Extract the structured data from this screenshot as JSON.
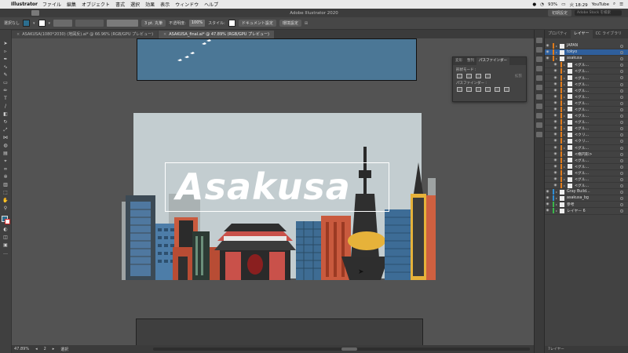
{
  "menubar": {
    "app": "Illustrator",
    "menus": [
      "ファイル",
      "編集",
      "オブジェクト",
      "書式",
      "選択",
      "効果",
      "表示",
      "ウィンドウ",
      "ヘルプ"
    ],
    "battery": "93%",
    "clock": "火 18:29",
    "user": "YouTube"
  },
  "titlebar": {
    "title": "Adobe Illustrator 2020",
    "workspace_btn": "初期設定",
    "search_placeholder": "Adobe Stock を検索"
  },
  "controlbar": {
    "selection": "選択なし",
    "stroke_width": "3 pt. 丸筆",
    "opacity_label": "不透明度:",
    "opacity": "100%",
    "style_label": "スタイル:",
    "doc_settings": "ドキュメント設定",
    "prefs": "環境設定",
    "fill_color": "#2c6e8f"
  },
  "tabs": [
    {
      "label": "ASAKUSA(1080*2030) (地図反).ai* @ 66.96% (RGB/GPU プレビュー)",
      "active": false
    },
    {
      "label": "ASAKUSA_final.ai* @ 47.89% (RGB/GPU プレビュー)",
      "active": true
    }
  ],
  "artwork": {
    "title": "Asakusa",
    "sky_color": "#c3cdd0",
    "top_board_color": "#4b7796"
  },
  "pathfinder": {
    "tabs": [
      "変形",
      "整列",
      "パスファインダー"
    ],
    "shape_modes_label": "形状モード :",
    "pathfinders_label": "パスファインダー :",
    "apply_label": "拡張"
  },
  "layers_panel": {
    "tabs": [
      "プロパティ",
      "レイヤー",
      "CC ライブラリ"
    ],
    "rows": [
      {
        "name": "JAPAN",
        "color": "#e07b1a",
        "selected": false,
        "sub": false
      },
      {
        "name": "tokyo",
        "color": "#e07b1a",
        "selected": true,
        "sub": false
      },
      {
        "name": "asakusa",
        "color": "#e07b1a",
        "selected": false,
        "sub": false
      },
      {
        "name": "<グル...",
        "color": "#e07b1a",
        "selected": false,
        "sub": true
      },
      {
        "name": "<グル...",
        "color": "#e07b1a",
        "selected": false,
        "sub": true
      },
      {
        "name": "<グル...",
        "color": "#e07b1a",
        "selected": false,
        "sub": true
      },
      {
        "name": "<グル...",
        "color": "#e07b1a",
        "selected": false,
        "sub": true
      },
      {
        "name": "<グル...",
        "color": "#e07b1a",
        "selected": false,
        "sub": true
      },
      {
        "name": "<グル...",
        "color": "#e07b1a",
        "selected": false,
        "sub": true
      },
      {
        "name": "<グル...",
        "color": "#e07b1a",
        "selected": false,
        "sub": true
      },
      {
        "name": "<グル...",
        "color": "#e07b1a",
        "selected": false,
        "sub": true
      },
      {
        "name": "<グル...",
        "color": "#e07b1a",
        "selected": false,
        "sub": true
      },
      {
        "name": "<グル...",
        "color": "#e07b1a",
        "selected": false,
        "sub": true
      },
      {
        "name": "<グル...",
        "color": "#e07b1a",
        "selected": false,
        "sub": true
      },
      {
        "name": "<クリ...",
        "color": "#e07b1a",
        "selected": false,
        "sub": true
      },
      {
        "name": "<クリ...",
        "color": "#e07b1a",
        "selected": false,
        "sub": true
      },
      {
        "name": "<グル...",
        "color": "#e07b1a",
        "selected": false,
        "sub": true
      },
      {
        "name": "<楕円形>",
        "color": "#e07b1a",
        "selected": false,
        "sub": true
      },
      {
        "name": "<グル...",
        "color": "#e07b1a",
        "selected": false,
        "sub": true
      },
      {
        "name": "<グル...",
        "color": "#e07b1a",
        "selected": false,
        "sub": true
      },
      {
        "name": "<グル...",
        "color": "#e07b1a",
        "selected": false,
        "sub": true
      },
      {
        "name": "<グル...",
        "color": "#e07b1a",
        "selected": false,
        "sub": true
      },
      {
        "name": "<グル...",
        "color": "#e07b1a",
        "selected": false,
        "sub": true
      },
      {
        "name": "Gray Build...",
        "color": "#2f8fd6",
        "selected": false,
        "sub": false
      },
      {
        "name": "asakusa_bg",
        "color": "#2f8fd6",
        "selected": false,
        "sub": false
      },
      {
        "name": "参考",
        "color": "#3ab54a",
        "selected": false,
        "sub": false
      },
      {
        "name": "レイヤー 6",
        "color": "#3ab54a",
        "selected": false,
        "sub": false
      }
    ],
    "footer": "7レイヤー"
  },
  "statusbar": {
    "zoom": "47.89%",
    "artboard": "2",
    "mode": "選択"
  }
}
